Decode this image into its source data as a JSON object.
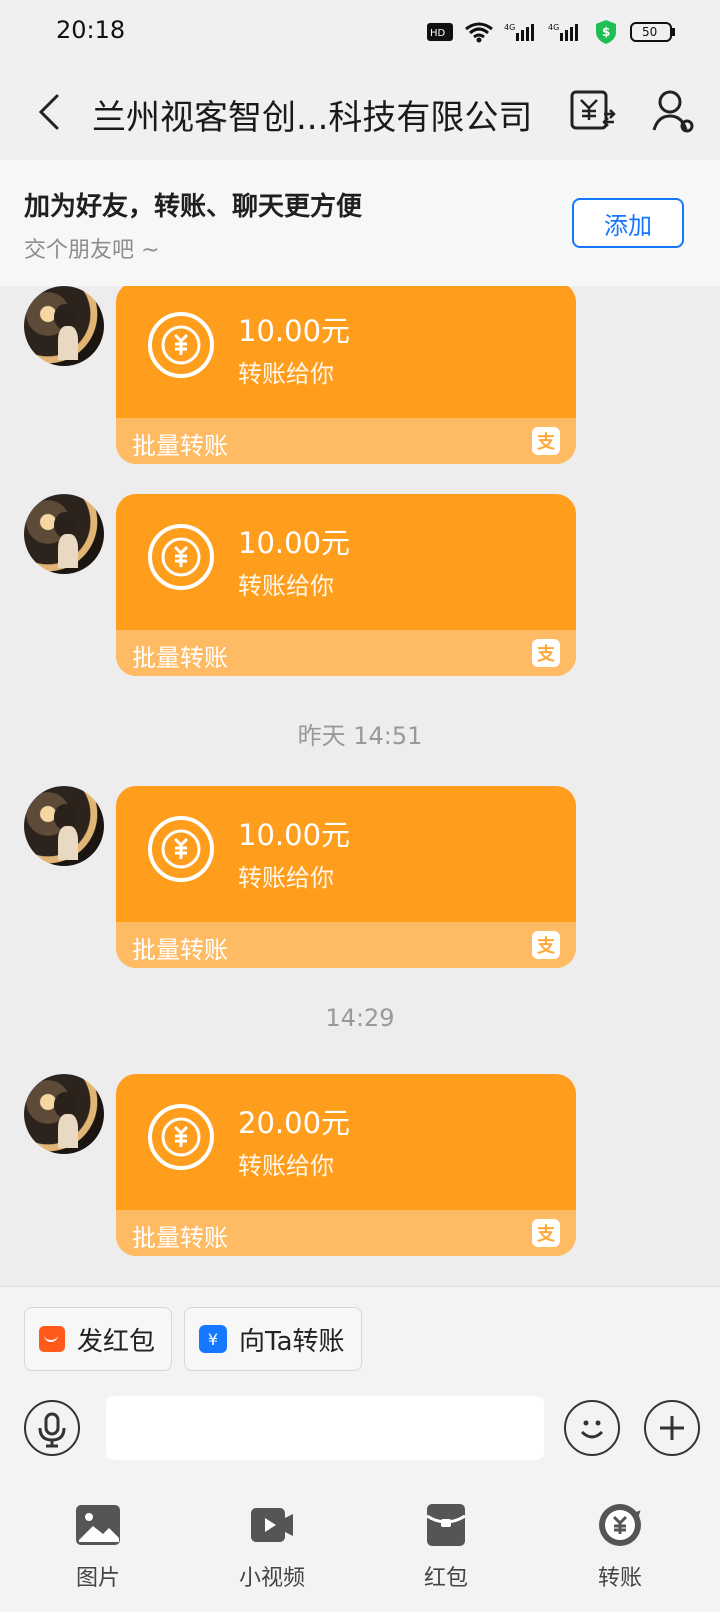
{
  "status_bar": {
    "time": "20:18",
    "icons": [
      "hd-icon",
      "wifi-icon",
      "signal-4g-icon",
      "signal-4g-icon",
      "shield-icon",
      "battery-icon"
    ],
    "battery": "50"
  },
  "header": {
    "title": "兰州视客智创...科技有限公司",
    "icons": [
      "back-icon",
      "bill-icon",
      "profile-icon"
    ]
  },
  "friend_banner": {
    "title": "加为好友，转账、聊天更方便",
    "subtitle": "交个朋友吧 ~",
    "button": "添加"
  },
  "messages": [
    {
      "amount": "10.00元",
      "desc": "转账给你",
      "footer": "批量转账",
      "icon": "alipay-icon"
    },
    {
      "amount": "10.00元",
      "desc": "转账给你",
      "footer": "批量转账",
      "icon": "alipay-icon"
    },
    {
      "divider": "昨天 14:51"
    },
    {
      "amount": "10.00元",
      "desc": "转账给你",
      "footer": "批量转账",
      "icon": "alipay-icon"
    },
    {
      "divider": "14:29"
    },
    {
      "amount": "20.00元",
      "desc": "转账给你",
      "footer": "批量转账",
      "icon": "alipay-icon"
    }
  ],
  "quick_actions": [
    {
      "label": "发红包",
      "icon": "red-envelope-icon"
    },
    {
      "label": "向Ta转账",
      "icon": "transfer-yuan-icon"
    }
  ],
  "input": {
    "placeholder": "",
    "icons": [
      "voice-icon",
      "emoji-icon",
      "plus-icon"
    ]
  },
  "bottom_tools": [
    {
      "label": "图片",
      "icon": "image-icon"
    },
    {
      "label": "小视频",
      "icon": "video-icon"
    },
    {
      "label": "红包",
      "icon": "red-packet-icon"
    },
    {
      "label": "转账",
      "icon": "transfer-icon"
    }
  ],
  "colors": {
    "accent": "#ff9d1c",
    "footer": "#ffbb64",
    "blue": "#1677ff",
    "red": "#ff5a1a"
  }
}
